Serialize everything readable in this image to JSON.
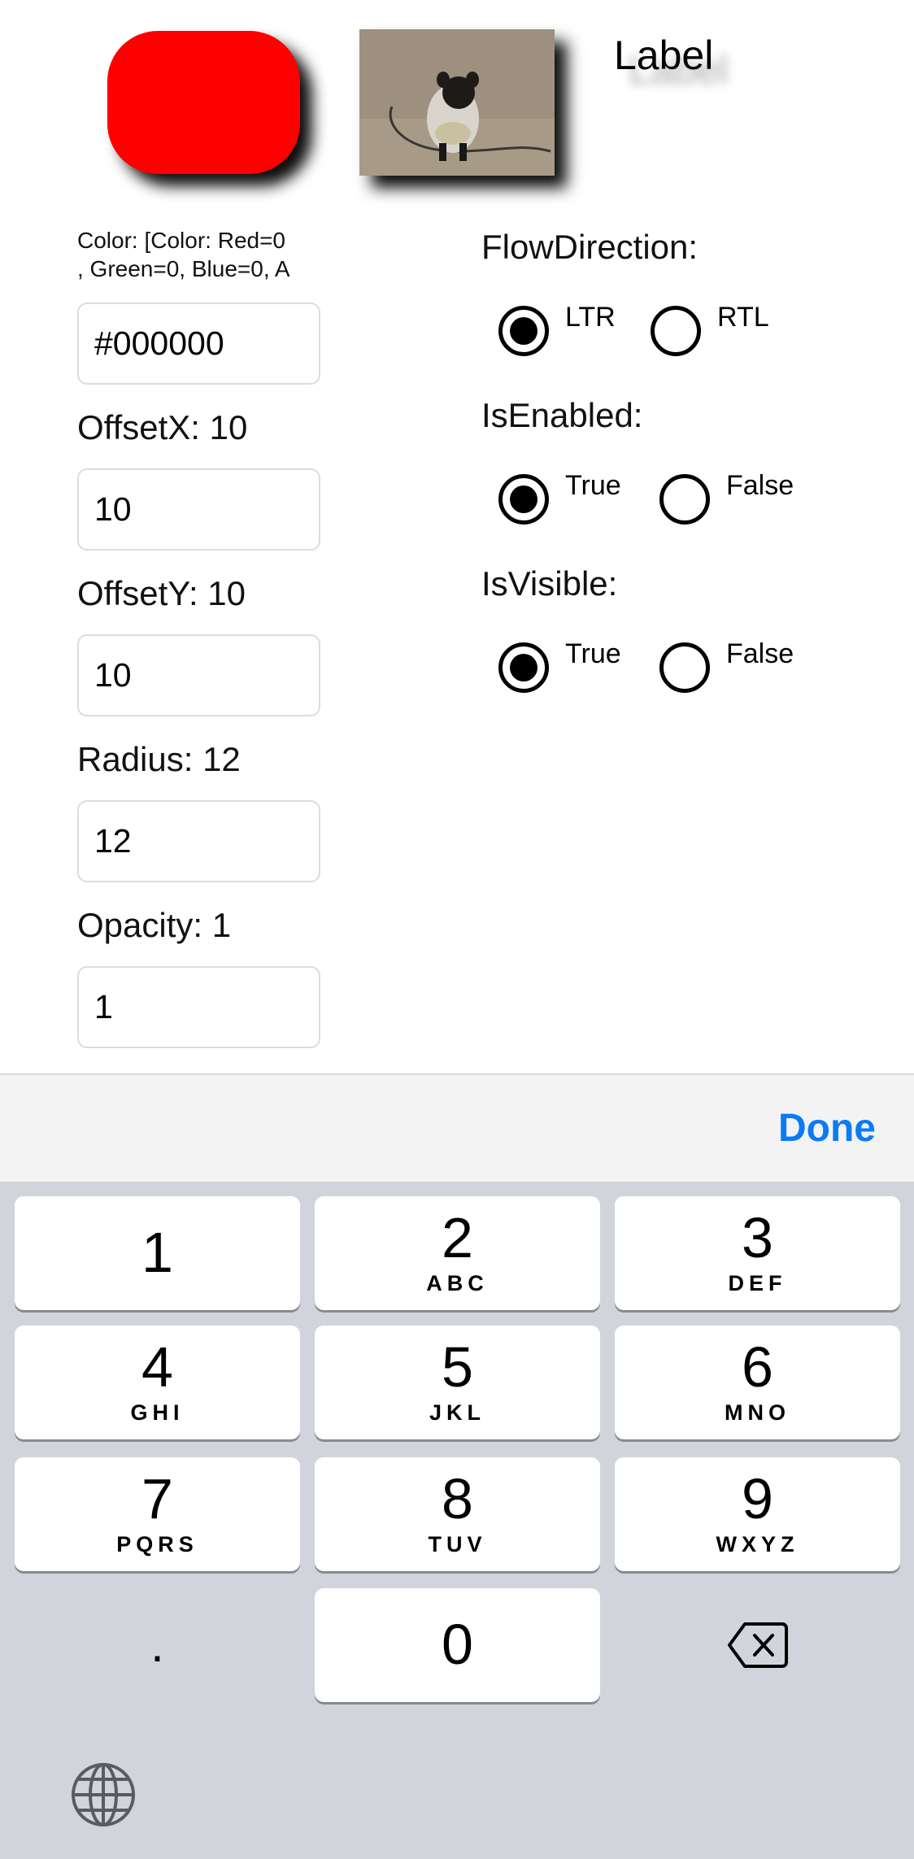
{
  "preview": {
    "shadow_label": "Label",
    "photo_alt": "pug-photo"
  },
  "color_caption": "Color: [Color: Red=0\n, Green=0, Blue=0, A",
  "fields": [
    {
      "label": "OffsetX: 10",
      "value": "10"
    },
    {
      "label": "OffsetY: 10",
      "value": "10"
    },
    {
      "label": "Radius: 12",
      "value": "12"
    },
    {
      "label": "Opacity: 1",
      "value": "1"
    }
  ],
  "color_entry": {
    "value": "#000000"
  },
  "flow_direction": {
    "label": "FlowDirection:",
    "options": [
      "LTR",
      "RTL"
    ],
    "selected": "LTR"
  },
  "is_enabled": {
    "label": "IsEnabled:",
    "options": [
      "True",
      "False"
    ],
    "selected": "True"
  },
  "is_visible": {
    "label": "IsVisible:",
    "options": [
      "True",
      "False"
    ],
    "selected": "True"
  },
  "keyboard": {
    "done_label": "Done",
    "keys": [
      {
        "digit": "1",
        "letters": ""
      },
      {
        "digit": "2",
        "letters": "ABC"
      },
      {
        "digit": "3",
        "letters": "DEF"
      },
      {
        "digit": "4",
        "letters": "GHI"
      },
      {
        "digit": "5",
        "letters": "JKL"
      },
      {
        "digit": "6",
        "letters": "MNO"
      },
      {
        "digit": "7",
        "letters": "PQRS"
      },
      {
        "digit": "8",
        "letters": "TUV"
      },
      {
        "digit": "9",
        "letters": "WXYZ"
      },
      {
        "digit": "0",
        "letters": ""
      }
    ],
    "decimal_key": ".",
    "backspace_icon": "backspace-icon",
    "globe_icon": "globe-icon"
  },
  "colors": {
    "red_box": "#ff0000",
    "accent": "#0a7bf5",
    "keyboard_bg": "#d1d4da"
  }
}
